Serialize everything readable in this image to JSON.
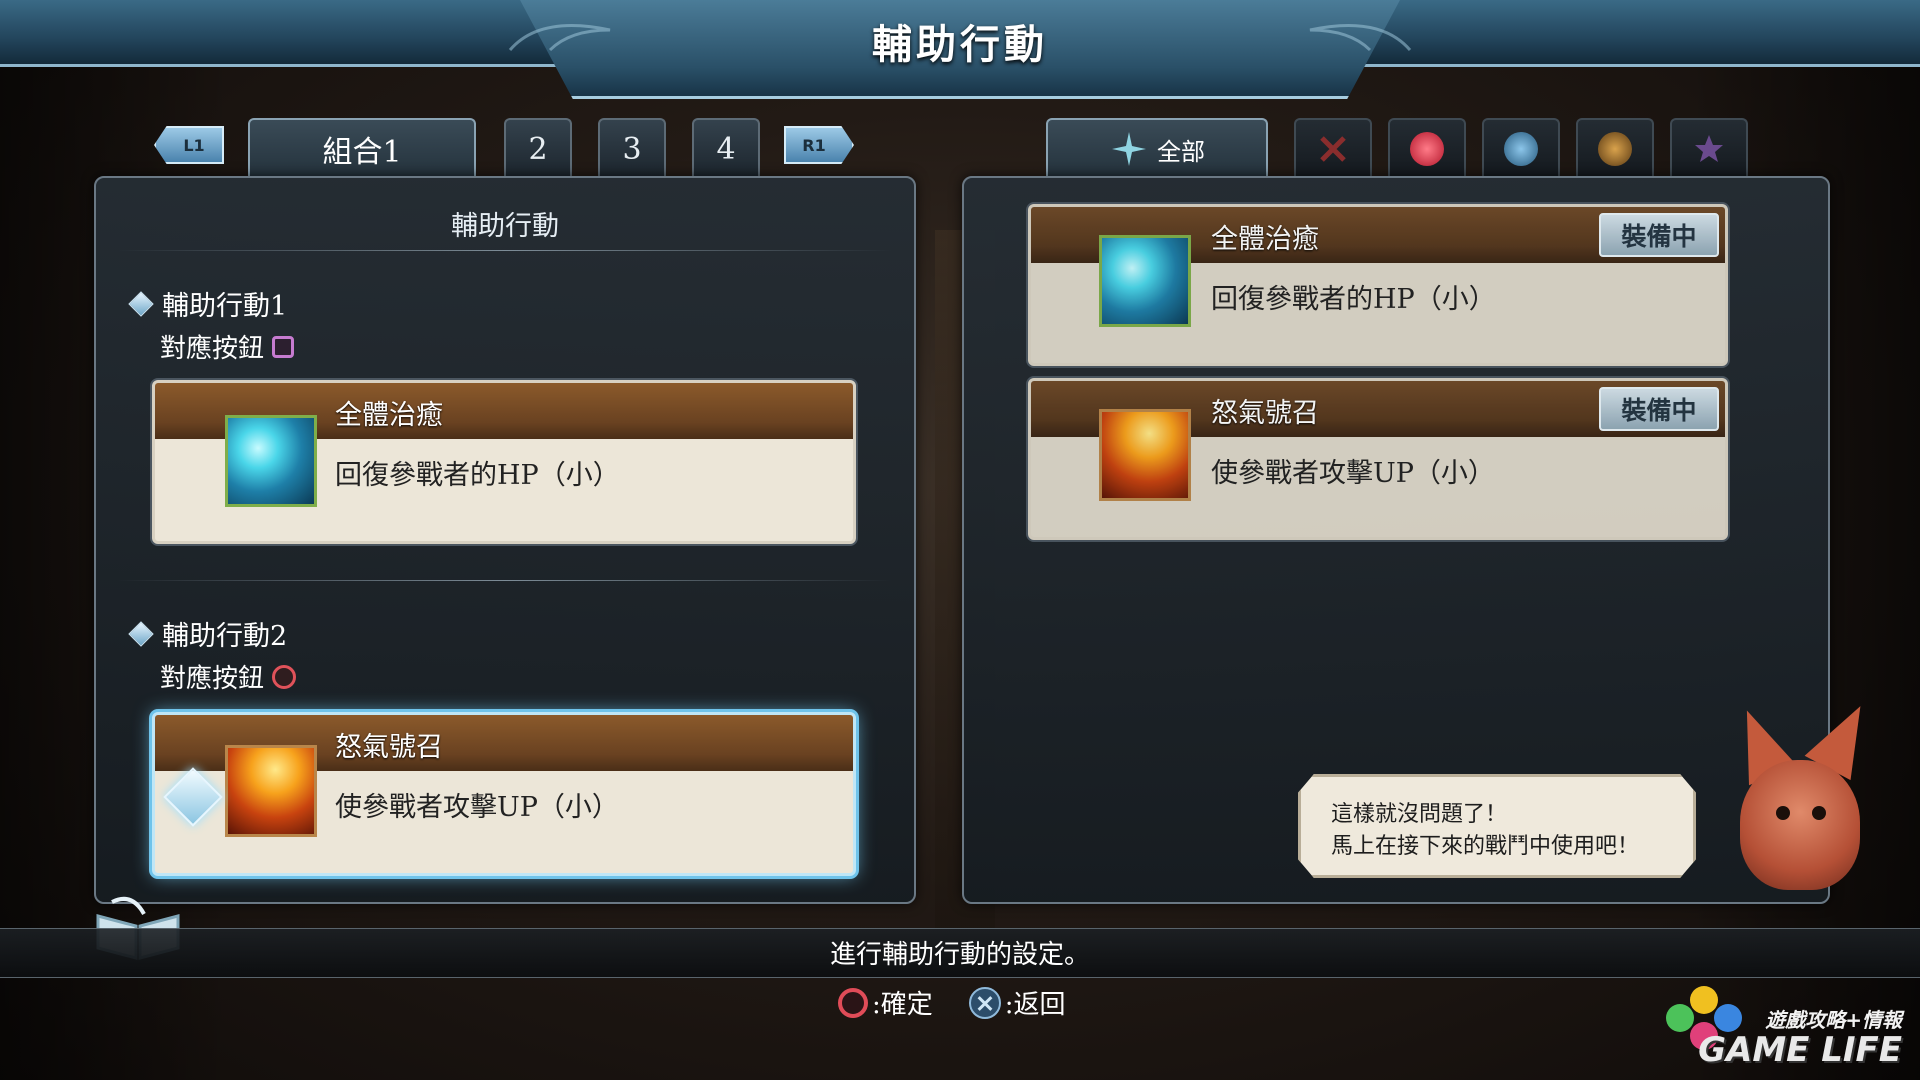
{
  "header": {
    "title": "輔助行動"
  },
  "set_tabs": {
    "left_shoulder": "L1",
    "right_shoulder": "R1",
    "tabs": [
      {
        "label": "組合1",
        "active": true
      },
      {
        "label": "2"
      },
      {
        "label": "3"
      },
      {
        "label": "4"
      }
    ]
  },
  "left_panel": {
    "heading": "輔助行動",
    "slots": [
      {
        "title": "輔助行動1",
        "button_label": "對應按鈕",
        "button_icon": "square-button-icon",
        "skill": {
          "name": "全體治癒",
          "desc": "回復參戰者的HP（小）",
          "icon": "heal-skill-icon"
        }
      },
      {
        "title": "輔助行動2",
        "button_label": "對應按鈕",
        "button_icon": "circle-button-icon",
        "skill": {
          "name": "怒氣號召",
          "desc": "使參戰者攻擊UP（小）",
          "icon": "rage-skill-icon"
        },
        "selected": true
      }
    ]
  },
  "filter_tabs": {
    "all_label": "全部",
    "icons": [
      "all-filter-icon",
      "sword-filter-icon",
      "heart-filter-icon",
      "shield-filter-icon",
      "orb-filter-icon",
      "star-filter-icon"
    ]
  },
  "skill_list": [
    {
      "name": "全體治癒",
      "desc": "回復參戰者的HP（小）",
      "badge": "裝備中",
      "icon": "heal-skill-icon"
    },
    {
      "name": "怒氣號召",
      "desc": "使參戰者攻擊UP（小）",
      "badge": "裝備中",
      "icon": "rage-skill-icon"
    }
  ],
  "speech": {
    "line1": "這樣就沒問題了！",
    "line2": "馬上在接下來的戰鬥中使用吧！"
  },
  "bottom": {
    "hint": "進行輔助行動的設定。",
    "confirm": ":確定",
    "back": ":返回"
  },
  "watermark": {
    "line1": "遊戲攻略+情報",
    "line2": "GAME LIFE"
  },
  "colors": {
    "accent": "#6fc3ea",
    "card_band": "#8b5a2b",
    "header": "#2a5068"
  }
}
